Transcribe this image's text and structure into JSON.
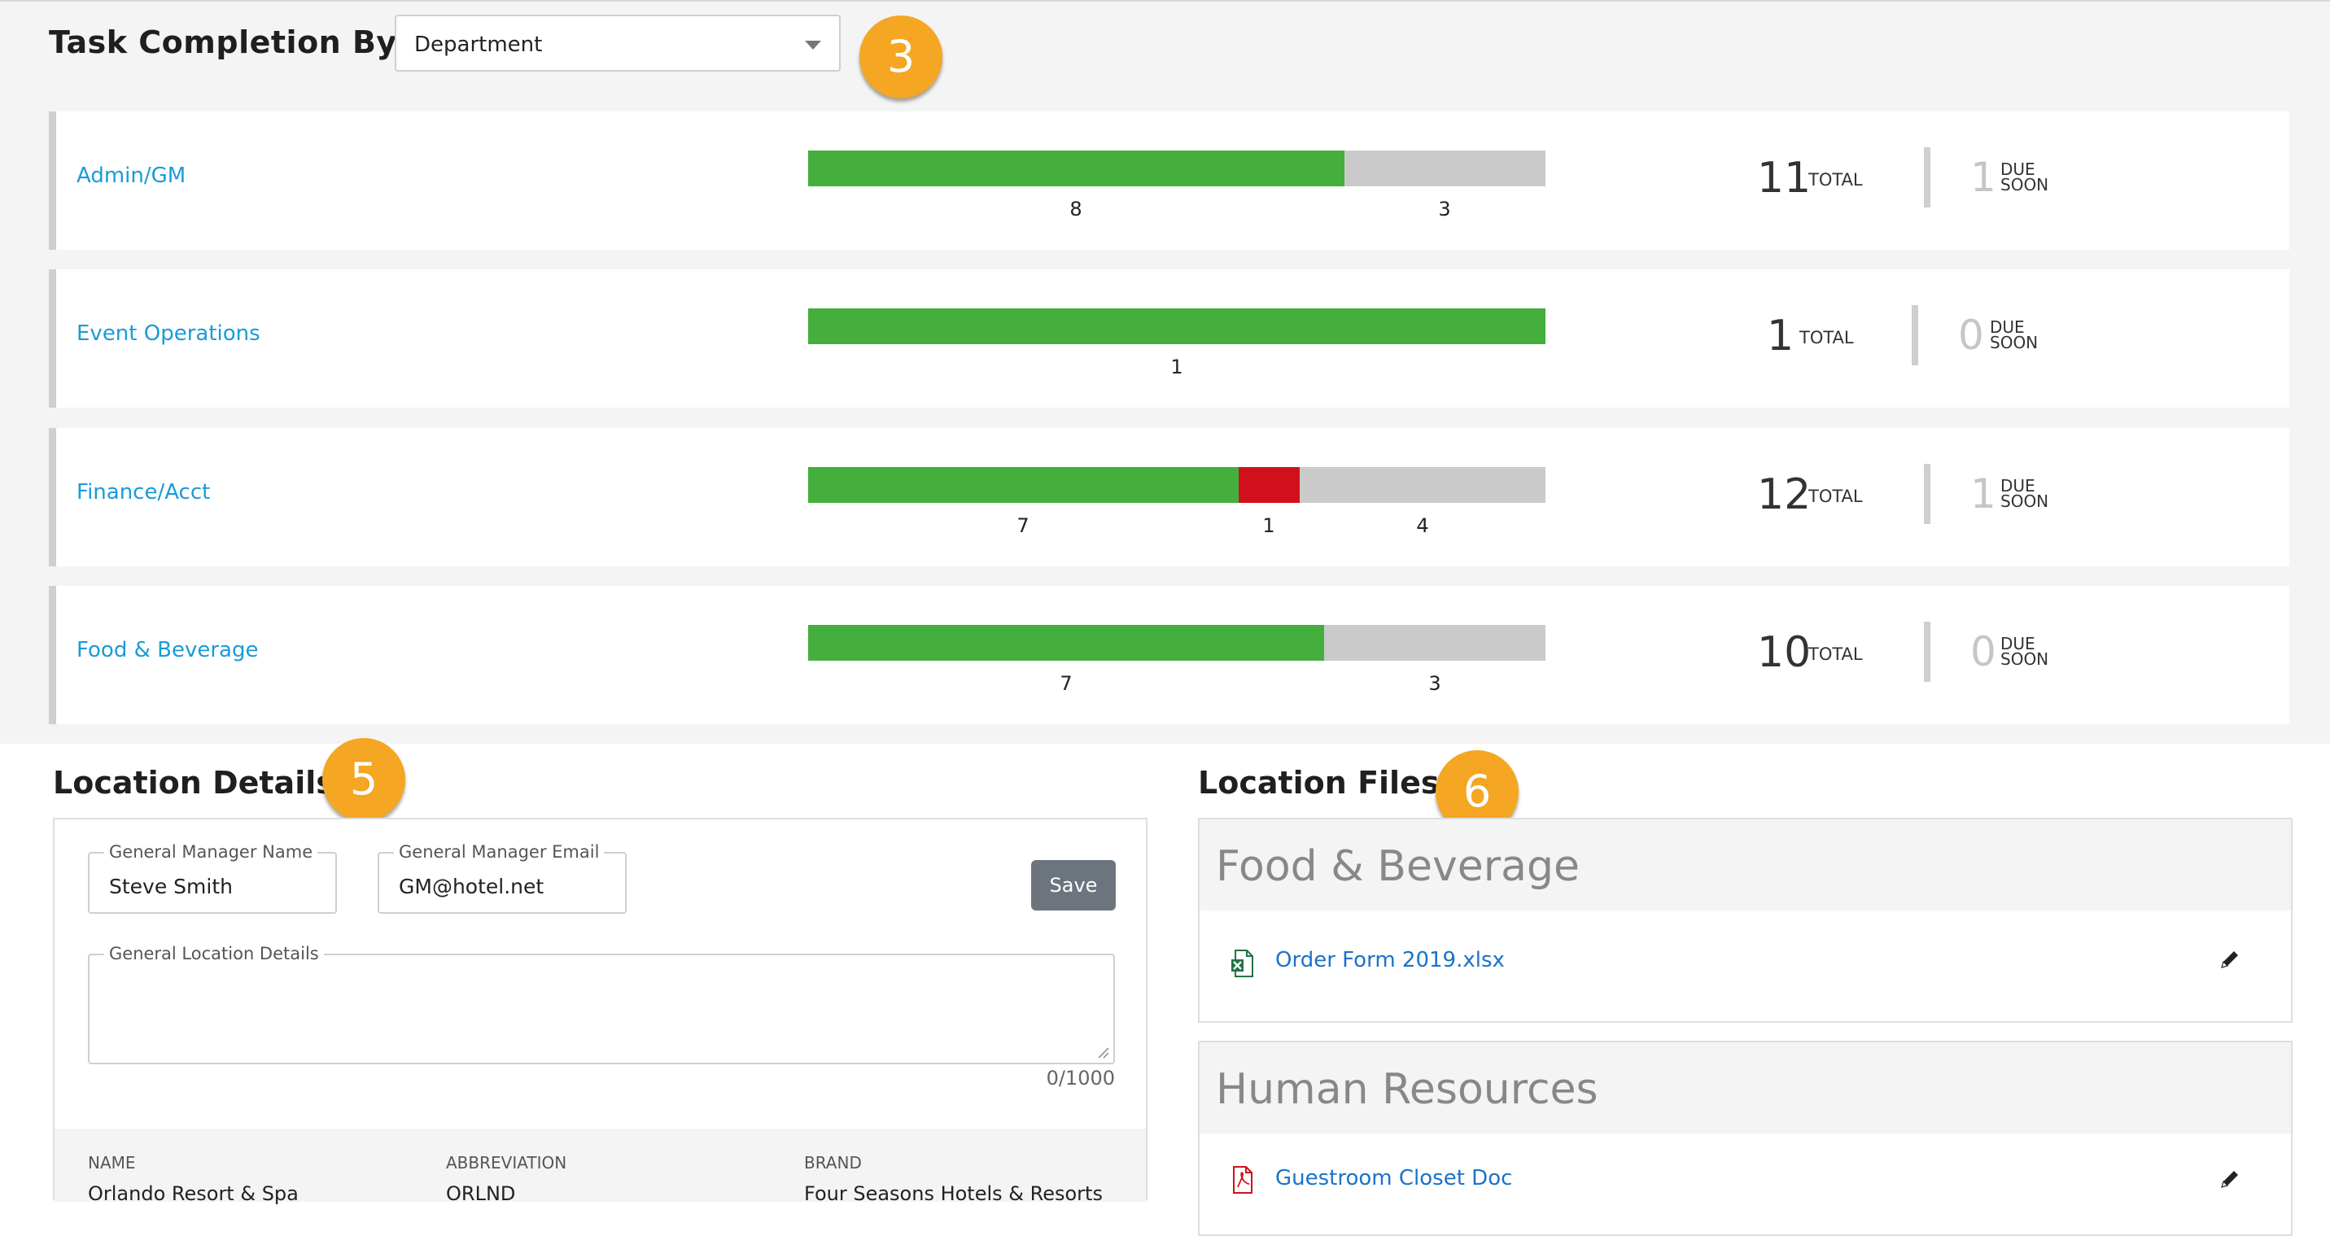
{
  "task_completion": {
    "title": "Task Completion By:",
    "select_value": "Department",
    "badge": "3",
    "total_label": "TOTAL",
    "due_label_1": "DUE",
    "due_label_2": "SOON",
    "rows": [
      {
        "name": "Admin/GM",
        "completed": 8,
        "overdue": 0,
        "remaining": 3,
        "total": "11",
        "due_soon": "1",
        "labels": [
          "8",
          "3"
        ]
      },
      {
        "name": "Event Operations",
        "completed": 1,
        "overdue": 0,
        "remaining": 0,
        "total": "1",
        "due_soon": "0",
        "labels": [
          "1"
        ]
      },
      {
        "name": "Finance/Acct",
        "completed": 7,
        "overdue": 1,
        "remaining": 4,
        "total": "12",
        "due_soon": "1",
        "labels": [
          "7",
          "1",
          "4"
        ]
      },
      {
        "name": "Food & Beverage",
        "completed": 7,
        "overdue": 0,
        "remaining": 3,
        "total": "10",
        "due_soon": "0",
        "labels": [
          "7",
          "3"
        ]
      }
    ],
    "colors": {
      "completed": "#44af3d",
      "overdue": "#d0111b",
      "remaining": "#cacaca",
      "link": "#1a9bd8",
      "badge": "#f5a623"
    }
  },
  "location_details": {
    "title": "Location Details",
    "badge": "5",
    "gm_name_label": "General Manager Name",
    "gm_name_value": "Steve Smith",
    "gm_email_label": "General Manager Email",
    "gm_email_value": "GM@hotel.net",
    "save_label": "Save",
    "details_label": "General Location Details",
    "details_value": "",
    "counter": "0/1000",
    "meta": [
      {
        "heading": "NAME",
        "value": "Orlando Resort & Spa"
      },
      {
        "heading": "ABBREVIATION",
        "value": "ORLND"
      },
      {
        "heading": "BRAND",
        "value": "Four Seasons Hotels & Resorts"
      }
    ]
  },
  "location_files": {
    "title": "Location Files",
    "badge": "6",
    "groups": [
      {
        "name": "Food & Beverage",
        "files": [
          {
            "name": "Order Form 2019.xlsx",
            "icon": "excel-file-icon"
          }
        ]
      },
      {
        "name": "Human Resources",
        "files": [
          {
            "name": "Guestroom Closet Doc",
            "icon": "pdf-file-icon"
          }
        ]
      }
    ]
  }
}
